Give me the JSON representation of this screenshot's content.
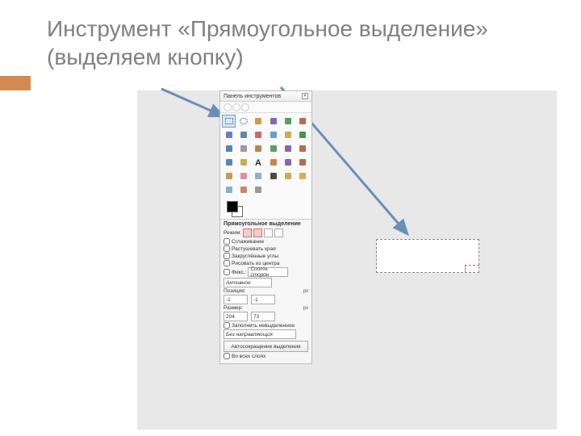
{
  "title": "Инструмент «Прямоугольное выделение» (выделяем кнопку)",
  "toolbox": {
    "title": "Панель инструментов",
    "close": "×",
    "tools": [
      "rect-select",
      "ellipse-select",
      "free-select",
      "fuzzy-select",
      "by-color-select",
      "scissors",
      "foreground",
      "paths",
      "color-picker",
      "zoom",
      "measure",
      "move",
      "align",
      "crop",
      "rotate",
      "scale",
      "shear",
      "perspective",
      "flip",
      "cage",
      "text",
      "bucket",
      "blend",
      "pencil",
      "paintbrush",
      "eraser",
      "airbrush",
      "ink",
      "clone",
      "heal",
      "blur",
      "smudge",
      "dodge"
    ],
    "selected_tool_index": 0
  },
  "options": {
    "header": "Прямоугольное выделение",
    "mode_label": "Режим:",
    "antialias": "Сглаживание",
    "feather": "Растушевать края",
    "rounded": "Закруглённые углы",
    "from_center": "Рисовать из центра",
    "fixed_label": "Фикс.:",
    "fixed_value": "Соотн. сторон",
    "active": "Активное",
    "position_label": "Позиция:",
    "pos_x": "-1",
    "pos_y": "-1",
    "pos_unit": "px",
    "size_label": "Размер:",
    "size_w": "204",
    "size_h": "73",
    "size_unit": "px",
    "fill_unselected": "Заполнить невыделенное",
    "guides_label": "Без направляющих",
    "autoshrink": "Автосокращение выделения",
    "all_layers": "Во всех слоях"
  }
}
